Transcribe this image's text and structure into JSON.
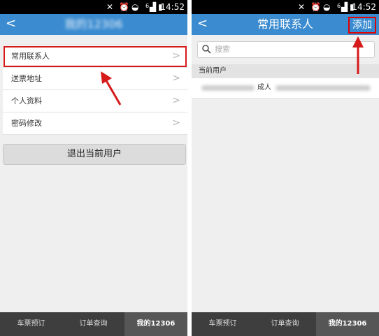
{
  "status_bar": {
    "time": "14:52",
    "network": "6"
  },
  "left": {
    "nav": {
      "title": "我的12306"
    },
    "menu": [
      {
        "label": "常用联系人"
      },
      {
        "label": "送票地址"
      },
      {
        "label": "个人资料"
      },
      {
        "label": "密码修改"
      }
    ],
    "logout_label": "退出当前用户"
  },
  "right": {
    "nav": {
      "title": "常用联系人",
      "add_label": "添加"
    },
    "search_placeholder": "搜索",
    "section_label": "当前用户",
    "contact_type": "成人"
  },
  "tabs": [
    {
      "label": "车票预订"
    },
    {
      "label": "订单查询"
    },
    {
      "label": "我的12306"
    }
  ],
  "colors": {
    "nav_blue": "#3a8bd0",
    "highlight_red": "#d61a1a",
    "tab_bar": "#3e3e3e"
  }
}
